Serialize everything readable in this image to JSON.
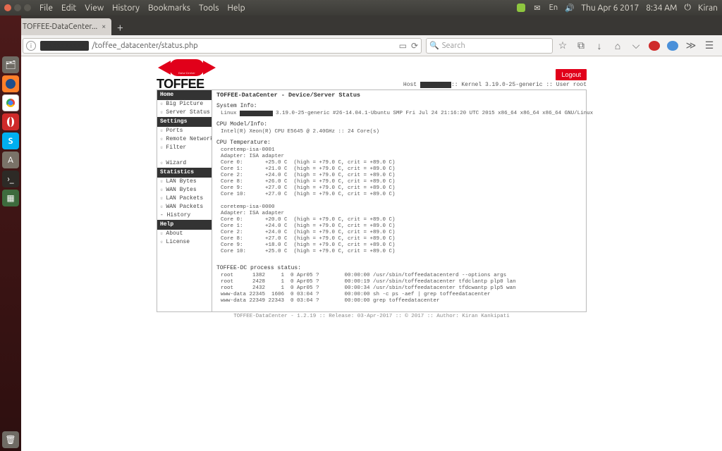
{
  "os_menu": {
    "file": "File",
    "edit": "Edit",
    "view": "View",
    "history": "History",
    "bookmarks": "Bookmarks",
    "tools": "Tools",
    "help": "Help"
  },
  "tray": {
    "date": "Thu Apr  6 2017",
    "time": "8:34 AM",
    "user": "Kiran"
  },
  "tab": {
    "title": "TOFFEE-DataCenter..."
  },
  "url": {
    "path": "/toffee_datacenter/status.php"
  },
  "search": {
    "placeholder": "Search"
  },
  "logout": "Logout",
  "hostline": {
    "prefix": "Host ",
    "kernel_label": ":: Kernel ",
    "kernel": "3.19.0-25-generic",
    "user_label": " :: User ",
    "user": "root"
  },
  "sidebar": {
    "home": "Home",
    "items1": [
      {
        "t": "Big Picture"
      },
      {
        "t": "Server Status"
      }
    ],
    "settings": "Settings",
    "items2": [
      {
        "t": "Ports"
      },
      {
        "t": "Remote Network"
      },
      {
        "t": "Filter"
      }
    ],
    "wizard": "Wizard",
    "stats": "Statistics",
    "items3": [
      {
        "t": "LAN Bytes"
      },
      {
        "t": "WAN Bytes"
      },
      {
        "t": "LAN Packets"
      },
      {
        "t": "WAN Packets"
      }
    ],
    "history": "History",
    "help": "Help",
    "items4": [
      {
        "t": "About"
      },
      {
        "t": "License"
      }
    ]
  },
  "page_title": "TOFFEE-DataCenter - Device/Server Status",
  "sys": {
    "label": "System Info:",
    "line_pre": "Linux ",
    "line_post": " 3.19.0-25-generic #26-14.04.1-Ubuntu SMP Fri Jul 24 21:16:20 UTC 2015 x86_64 x86_64 x86_64 GNU/Linux"
  },
  "cpu": {
    "label": "CPU Model/Info:",
    "line": "Intel(R) Xeon(R) CPU E5645 @ 2.40GHz :: 24 Core(s)"
  },
  "temp_label": "CPU Temperature:",
  "temp_block": "coretemp-isa-0001\nAdapter: ISA adapter\nCore 0:       +25.0 C  (high = +79.0 C, crit = +89.0 C)\nCore 1:       +21.0 C  (high = +79.0 C, crit = +89.0 C)\nCore 2:       +24.0 C  (high = +79.0 C, crit = +89.0 C)\nCore 8:       +26.0 C  (high = +79.0 C, crit = +89.0 C)\nCore 9:       +27.0 C  (high = +79.0 C, crit = +89.0 C)\nCore 10:      +27.0 C  (high = +79.0 C, crit = +89.0 C)\n\ncoretemp-isa-0000\nAdapter: ISA adapter\nCore 0:       +20.0 C  (high = +79.0 C, crit = +89.0 C)\nCore 1:       +24.0 C  (high = +79.0 C, crit = +89.0 C)\nCore 2:       +24.0 C  (high = +79.0 C, crit = +89.0 C)\nCore 8:       +27.0 C  (high = +79.0 C, crit = +89.0 C)\nCore 9:       +18.0 C  (high = +79.0 C, crit = +89.0 C)\nCore 10:      +25.0 C  (high = +79.0 C, crit = +89.0 C)",
  "proc_label": "TOFFEE-DC process status:",
  "proc_block": "root      1382     1  0 Apr05 ?        00:00:00 /usr/sbin/toffeedatacenterd --options args\nroot      2428     1  0 Apr05 ?        00:00:19 /usr/sbin/toffeedatacenter tfdclantp plp0 lan\nroot      2432     1  0 Apr05 ?        00:00:34 /usr/sbin/toffeedatacenter tfdcwantp plp5 wan\nwww-data 22345  1606  0 03:04 ?        00:00:00 sh -c ps -aef | grep toffeedatacenter\nwww-data 22349 22343  0 03:04 ?        00:00:00 grep toffeedatacenter",
  "footer": "TOFFEE-DataCenter - 1.2.19 :: Release: 03-Apr-2017 :: © 2017 :: Author: Kiran Kankipati"
}
